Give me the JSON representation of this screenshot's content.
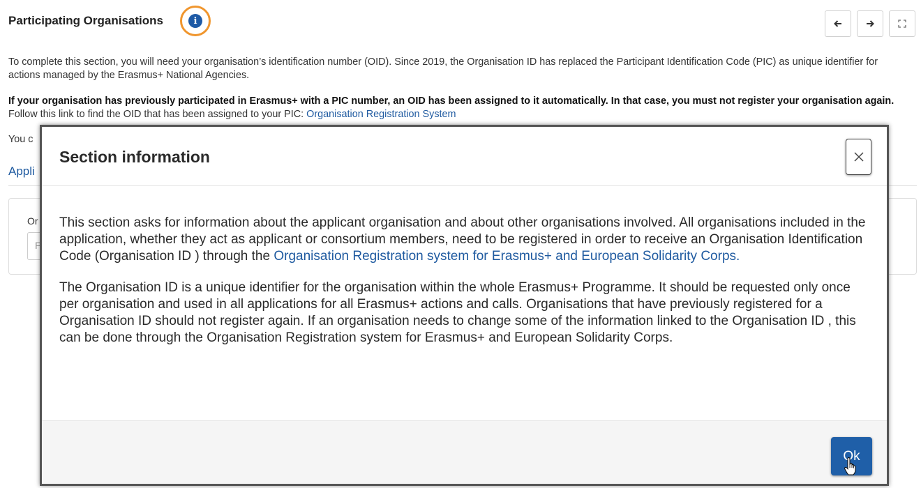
{
  "page": {
    "title": "Participating Organisations",
    "intro": "To complete this section, you will need your organisation’s identification number (OID). Since 2019, the Organisation ID has replaced the Participant Identification Code (PIC) as unique identifier for actions managed by the Erasmus+ National Agencies.",
    "notice_bold": "If your organisation has previously participated in Erasmus+ with a PIC number, an OID has been assigned to it automatically. In that case, you must not register your organisation again.",
    "notice_rest": " Follow this link to find the OID that has been assigned to your PIC: ",
    "notice_link": "Organisation Registration System",
    "partial_text": "You c",
    "partial_heading": "Appli",
    "card_label_partial": "Or",
    "card_input_partial": "P"
  },
  "nav": {
    "prev_icon": "arrow-left-icon",
    "next_icon": "arrow-right-icon",
    "expand_icon": "expand-icon"
  },
  "modal": {
    "title": "Section information",
    "para1_text": "This section asks for information about the applicant organisation and about other organisations involved. All organisations included in the application, whether they act as applicant or consortium members, need to be registered in order to receive an Organisation Identification Code (Organisation ID ) through the ",
    "para1_link": "Organisation Registration system for Erasmus+ and European Solidarity Corps.",
    "para2": "The Organisation ID is a unique identifier for the organisation within the whole Erasmus+ Programme. It should be requested only once per organisation and used in all applications for all Erasmus+ actions and calls. Organisations that have previously registered for a Organisation ID should not register again. If an organisation needs to change some of the information linked to the Organisation ID , this can be done through the Organisation Registration system for Erasmus+ and European Solidarity Corps.",
    "ok_label": "Ok"
  },
  "colors": {
    "accent": "#1f5fa8",
    "highlight": "#f0962e",
    "link": "#1f5aa0"
  }
}
